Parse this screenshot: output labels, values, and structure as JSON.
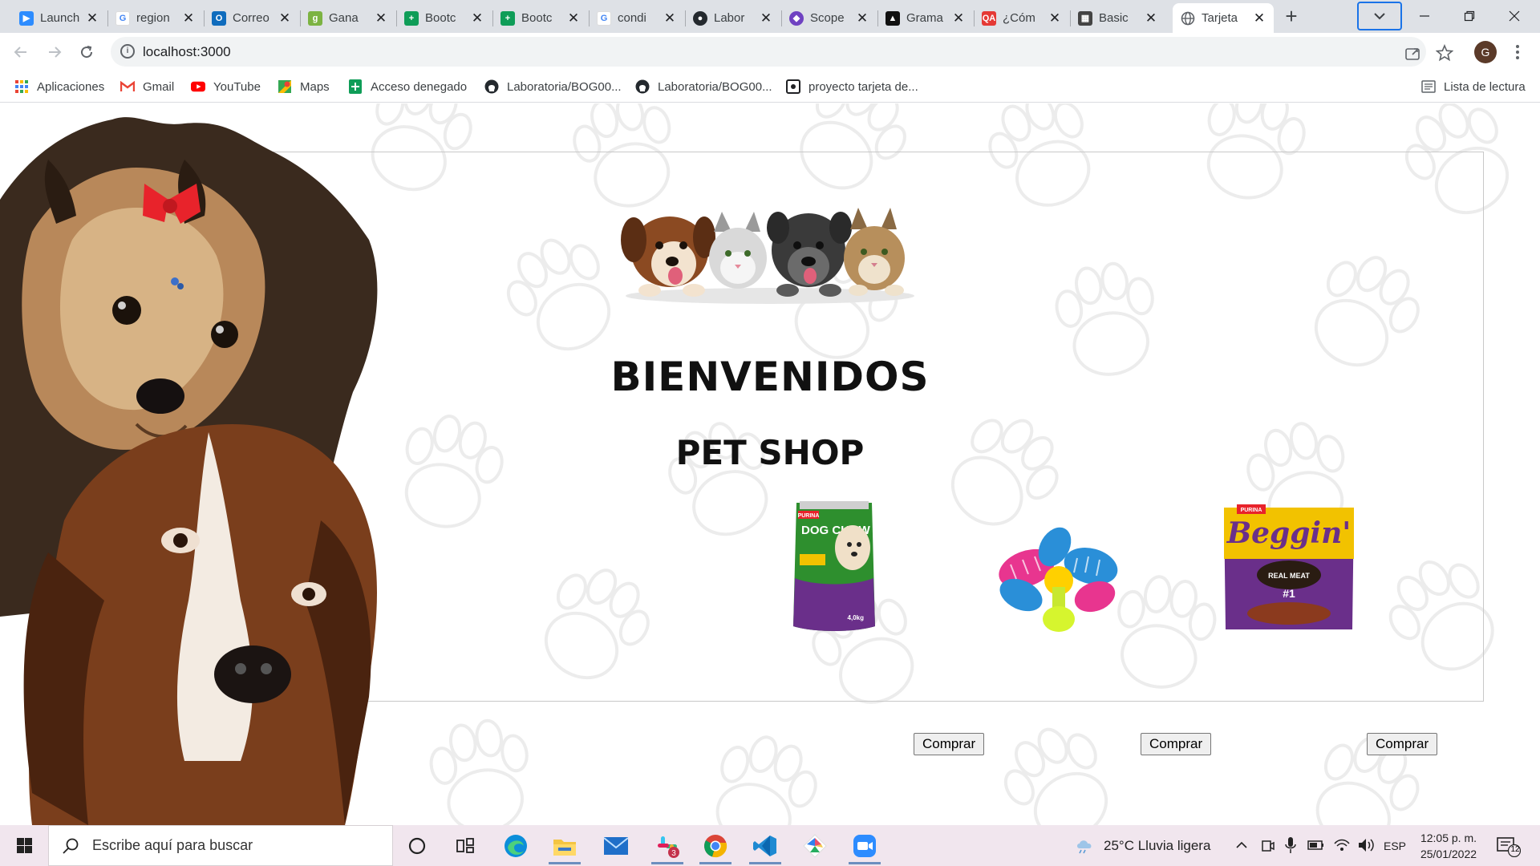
{
  "browser": {
    "tabs": [
      {
        "title": "Launch",
        "favicon": "zoom-icon",
        "color": "#2d8cff"
      },
      {
        "title": "region",
        "favicon": "google-icon",
        "color": "#4285f4"
      },
      {
        "title": "Correo",
        "favicon": "outlook-icon",
        "color": "#0f6cbd"
      },
      {
        "title": "Gana",
        "favicon": "g-green-icon",
        "color": "#7cb342"
      },
      {
        "title": "Bootc",
        "favicon": "sheets-icon",
        "color": "#0f9d58"
      },
      {
        "title": "Bootc",
        "favicon": "sheets-icon",
        "color": "#0f9d58"
      },
      {
        "title": "condi",
        "favicon": "google-icon",
        "color": "#4285f4"
      },
      {
        "title": "Labor",
        "favicon": "github-icon",
        "color": "#24292e"
      },
      {
        "title": "Scope",
        "favicon": "scope-icon",
        "color": "#6f42c1"
      },
      {
        "title": "Grama",
        "favicon": "grammar-icon",
        "color": "#111111"
      },
      {
        "title": "¿Cóm",
        "favicon": "qa-icon",
        "color": "#e53935"
      },
      {
        "title": "Basic",
        "favicon": "basic-icon",
        "color": "#444444"
      },
      {
        "title": "Tarjeta",
        "favicon": "globe-icon",
        "color": "#5f6368",
        "active": true
      }
    ],
    "url": "localhost:3000",
    "profile_initial": "G",
    "bookmarks": [
      {
        "label": "Aplicaciones",
        "icon": "apps-grid-icon"
      },
      {
        "label": "Gmail",
        "icon": "gmail-icon"
      },
      {
        "label": "YouTube",
        "icon": "youtube-icon"
      },
      {
        "label": "Maps",
        "icon": "maps-icon"
      },
      {
        "label": "Acceso denegado",
        "icon": "sheets-icon"
      },
      {
        "label": "Laboratoria/BOG00...",
        "icon": "github-icon"
      },
      {
        "label": "Laboratoria/BOG00...",
        "icon": "github-icon"
      },
      {
        "label": "proyecto tarjeta de...",
        "icon": "page-icon"
      }
    ],
    "reading_list": "Lista de lectura"
  },
  "page": {
    "title": "BIENVENIDOS",
    "subtitle": "PET SHOP",
    "products": [
      {
        "name": "DOG CHOW",
        "brand": "PURINA",
        "weight": "4,0kg",
        "image": "dog-chow-bag-image",
        "button": "Comprar"
      },
      {
        "name": "toy",
        "image": "rubber-toy-image",
        "button": "Comprar"
      },
      {
        "name": "Beggin'",
        "brand": "PURINA",
        "tag": "REAL MEAT",
        "rank": "#1",
        "image": "beggin-pack-image",
        "button": "Comprar"
      }
    ]
  },
  "taskbar": {
    "search_placeholder": "Escribe aquí para buscar",
    "weather": "25°C  Lluvia ligera",
    "language": "ESP",
    "time": "12:05 p. m.",
    "date": "25/01/2022",
    "notifications": "12",
    "slack_badge": "3"
  },
  "colors": {
    "tab_strip": "#dee1e6",
    "taskbar": "#f1e6ee",
    "paw_outline": "#ececec",
    "active_indicator": "#1a73e8"
  }
}
